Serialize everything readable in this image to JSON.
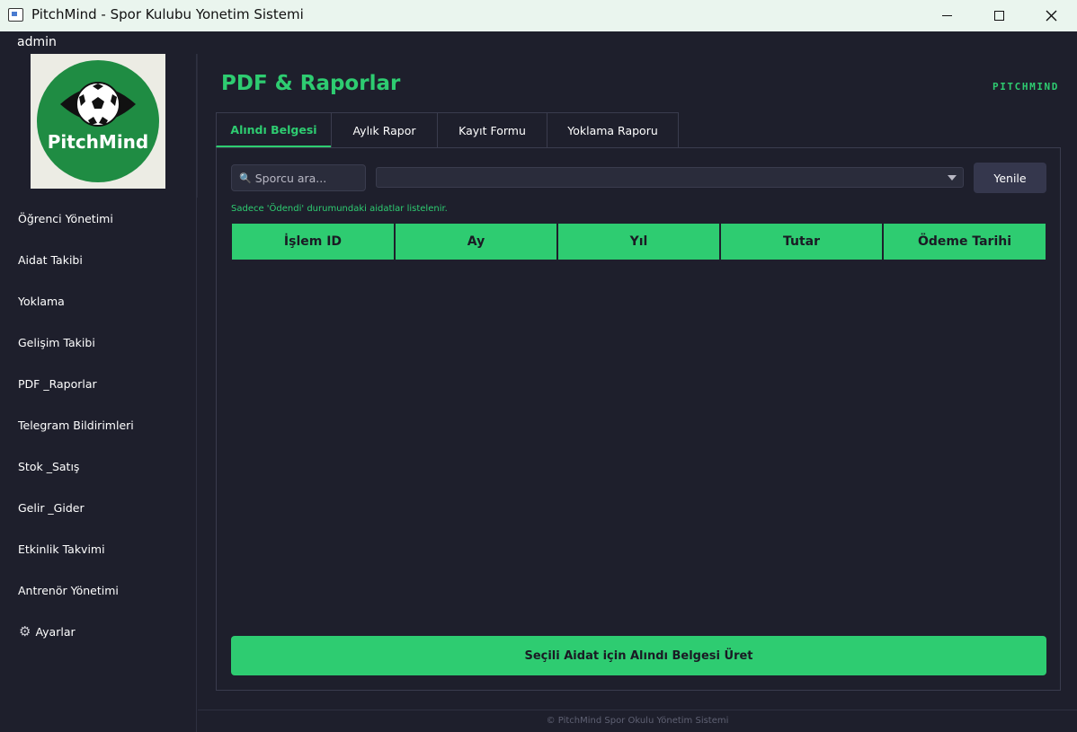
{
  "window": {
    "title": "PitchMind - Spor Kulubu Yonetim Sistemi"
  },
  "menubar": {
    "user": "admin"
  },
  "sidebar": {
    "logo_text": "PitchMind",
    "items": [
      {
        "label": "Öğrenci Yönetimi"
      },
      {
        "label": "Aidat Takibi"
      },
      {
        "label": "Yoklama"
      },
      {
        "label": "Gelişim Takibi"
      },
      {
        "label": "PDF _Raporlar"
      },
      {
        "label": "Telegram Bildirimleri"
      },
      {
        "label": "Stok _Satış"
      },
      {
        "label": "Gelir _Gider"
      },
      {
        "label": "Etkinlik Takvimi"
      },
      {
        "label": "Antrenör Yönetimi"
      },
      {
        "label": "Ayarlar",
        "icon": "gear-icon"
      }
    ]
  },
  "header": {
    "title": "PDF & Raporlar",
    "brand": "PITCHMIND"
  },
  "tabs": [
    {
      "label": "Alındı Belgesi",
      "active": true
    },
    {
      "label": "Aylık Rapor"
    },
    {
      "label": "Kayıt Formu"
    },
    {
      "label": "Yoklama Raporu"
    }
  ],
  "receipt": {
    "search_placeholder": "Sporcu ara...",
    "select_value": "",
    "refresh_label": "Yenile",
    "hint": "Sadece 'Ödendi' durumundaki aidatlar listelenir.",
    "columns": [
      "İşlem ID",
      "Ay",
      "Yıl",
      "Tutar",
      "Ödeme Tarihi"
    ],
    "rows": [],
    "generate_label": "Seçili Aidat için Alındı Belgesi Üret"
  },
  "footer": {
    "text": "©  PitchMind Spor Okulu Yönetim Sistemi"
  },
  "colors": {
    "accent": "#2ecc71",
    "background": "#1e1f2c",
    "logo_green": "#1f8c43"
  }
}
